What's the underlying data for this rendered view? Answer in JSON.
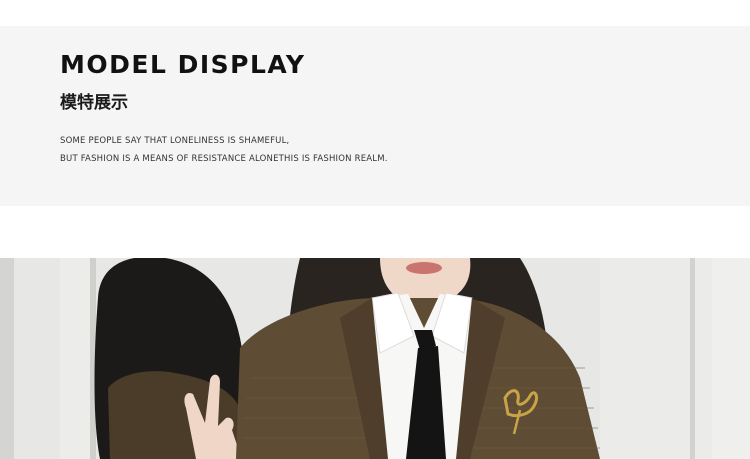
{
  "header": {
    "title": "MODEL DISPLAY",
    "subtitle": "模特展示",
    "description_lines": [
      "SOME PEOPLE SAY THAT LONELINESS IS SHAMEFUL,",
      "BUT FASHION IS A MEANS OF RESISTANCE ALONETHIS IS FASHION REALM."
    ]
  },
  "colors": {
    "banner_background": "#f5f5f5",
    "title_text": "#111111",
    "blazer_brown": "#5e4c34",
    "tie_black": "#141414",
    "shirt_white": "#f7f7f5"
  }
}
